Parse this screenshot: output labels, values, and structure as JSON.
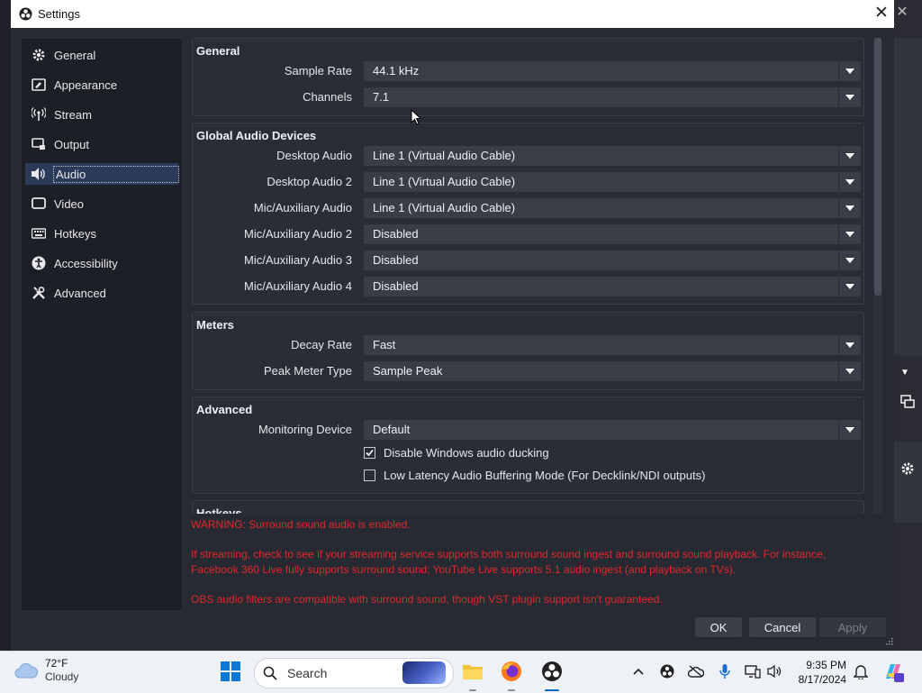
{
  "window": {
    "title": "Settings"
  },
  "sidebar": {
    "items": [
      {
        "label": "General",
        "icon": "gear-icon"
      },
      {
        "label": "Appearance",
        "icon": "appearance-icon"
      },
      {
        "label": "Stream",
        "icon": "broadcast-icon"
      },
      {
        "label": "Output",
        "icon": "output-icon"
      },
      {
        "label": "Audio",
        "icon": "speaker-icon",
        "active": true
      },
      {
        "label": "Video",
        "icon": "monitor-icon"
      },
      {
        "label": "Hotkeys",
        "icon": "keyboard-icon"
      },
      {
        "label": "Accessibility",
        "icon": "accessibility-icon"
      },
      {
        "label": "Advanced",
        "icon": "tools-icon"
      }
    ]
  },
  "general": {
    "title": "General",
    "sample_rate": {
      "label": "Sample Rate",
      "value": "44.1 kHz"
    },
    "channels": {
      "label": "Channels",
      "value": "7.1"
    }
  },
  "global_audio": {
    "title": "Global Audio Devices",
    "rows": [
      {
        "label": "Desktop Audio",
        "value": "Line 1 (Virtual Audio Cable)"
      },
      {
        "label": "Desktop Audio 2",
        "value": "Line 1 (Virtual Audio Cable)"
      },
      {
        "label": "Mic/Auxiliary Audio",
        "value": "Line 1 (Virtual Audio Cable)"
      },
      {
        "label": "Mic/Auxiliary Audio 2",
        "value": "Disabled"
      },
      {
        "label": "Mic/Auxiliary Audio 3",
        "value": "Disabled"
      },
      {
        "label": "Mic/Auxiliary Audio 4",
        "value": "Disabled"
      }
    ]
  },
  "meters": {
    "title": "Meters",
    "decay_rate": {
      "label": "Decay Rate",
      "value": "Fast"
    },
    "peak_meter_type": {
      "label": "Peak Meter Type",
      "value": "Sample Peak"
    }
  },
  "advanced": {
    "title": "Advanced",
    "monitoring_device": {
      "label": "Monitoring Device",
      "value": "Default"
    },
    "disable_ducking": {
      "label": "Disable Windows audio ducking",
      "checked": true
    },
    "low_latency": {
      "label": "Low Latency Audio Buffering Mode (For Decklink/NDI outputs)",
      "checked": false
    }
  },
  "hotkeys_section": {
    "title": "Hotkeys"
  },
  "warning": {
    "line1": "WARNING: Surround sound audio is enabled.",
    "line2": "If streaming, check to see if your streaming service supports both surround sound ingest and surround sound playback. For instance, Facebook 360 Live fully supports surround sound; YouTube Live supports 5.1 audio ingest (and playback on TVs).",
    "line3": "OBS audio filters are compatible with surround sound, though VST plugin support isn't guaranteed."
  },
  "buttons": {
    "ok": "OK",
    "cancel": "Cancel",
    "apply": "Apply"
  },
  "taskbar": {
    "weather_temp": "72°F",
    "weather_desc": "Cloudy",
    "search_placeholder": "Search",
    "time": "9:35 PM",
    "date": "8/17/2024"
  },
  "colors": {
    "warning": "#e0282b",
    "panel": "#2a2d36",
    "sidebar": "#1d1f26",
    "active_nav": "#2c3a5a",
    "taskbar_active": "#0067c0"
  }
}
